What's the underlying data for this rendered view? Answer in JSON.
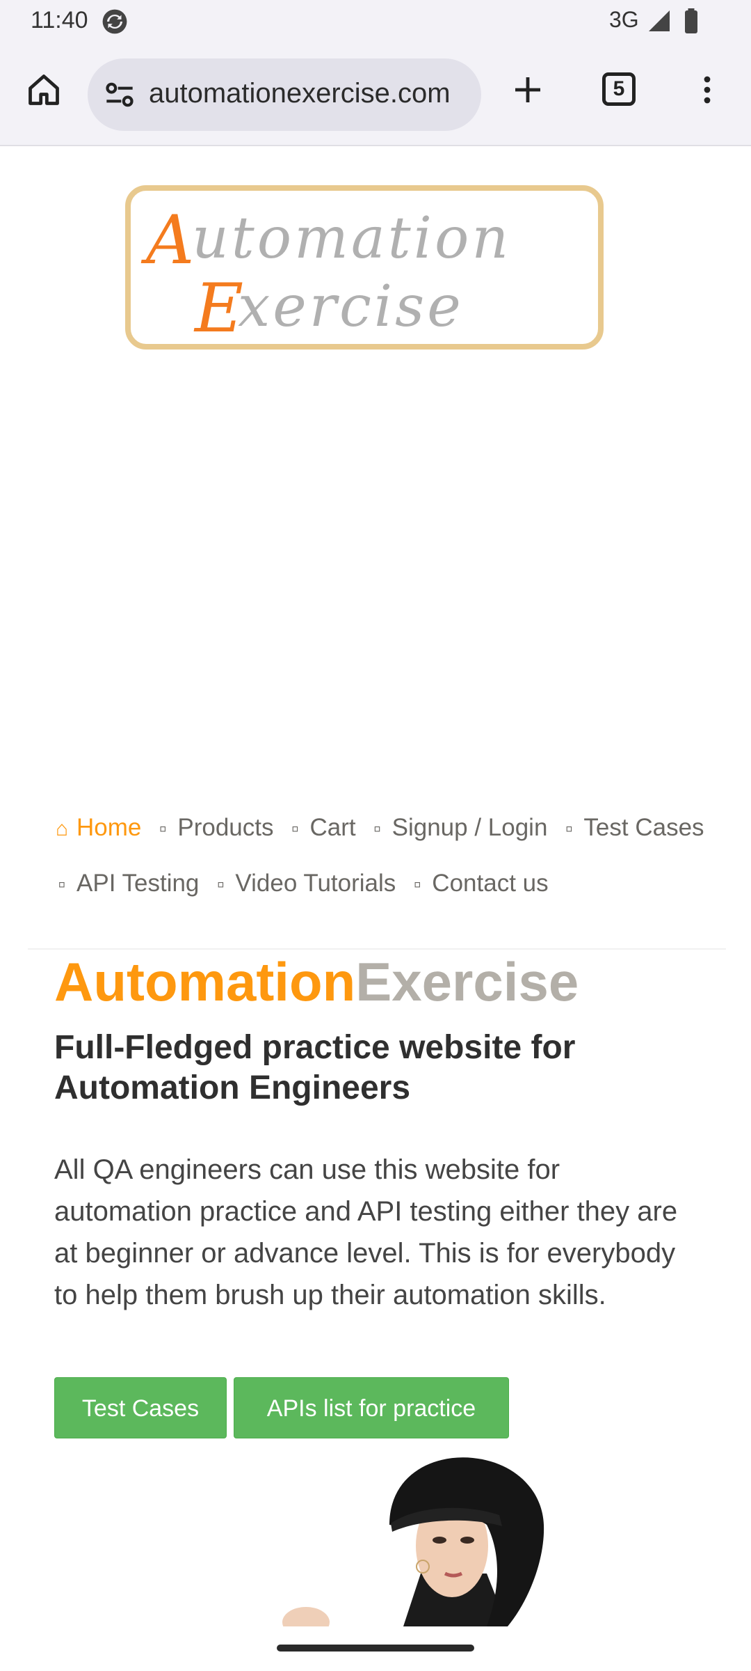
{
  "status_bar": {
    "time": "11:40",
    "network": "3G"
  },
  "browser": {
    "url": "automationexercise.com",
    "tab_count": "5"
  },
  "logo": {
    "alt_line1": "Automation",
    "alt_line2": "Exercise"
  },
  "nav": {
    "items": [
      {
        "label": "Home",
        "active": true
      },
      {
        "label": "Products"
      },
      {
        "label": "Cart"
      },
      {
        "label": "Signup / Login"
      },
      {
        "label": "Test Cases"
      },
      {
        "label": "API Testing"
      },
      {
        "label": "Video Tutorials"
      },
      {
        "label": "Contact us"
      }
    ]
  },
  "hero": {
    "title_part1": "Automation",
    "title_part2": "Exercise",
    "subtitle": "Full-Fledged practice website for Automation Engineers",
    "description": "All QA engineers can use this website for automation practice and API testing either they are at beginner or advance level. This is for everybody to help them brush up their automation skills.",
    "btn_test_cases": "Test Cases",
    "btn_apis": "APIs list for practice"
  },
  "colors": {
    "brand_orange": "#fe980f",
    "brand_gray": "#b3afa8",
    "button_green": "#5cb85c"
  }
}
